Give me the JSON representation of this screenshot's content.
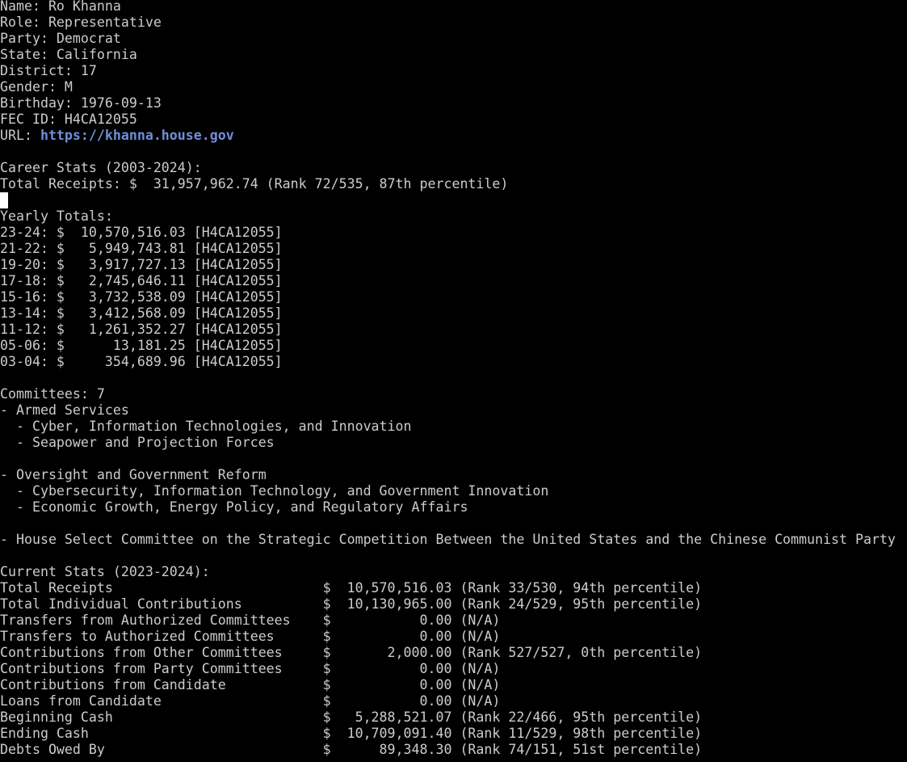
{
  "profile": {
    "name_line": "Name: Ro Khanna",
    "role_line": "Role: Representative",
    "party_line": "Party: Democrat",
    "state_line": "State: California",
    "district_line": "District: 17",
    "gender_line": "Gender: M",
    "birthday_line": "Birthday: 1976-09-13",
    "fec_line": "FEC ID: H4CA12055",
    "url_label": "URL: ",
    "url": "https://khanna.house.gov"
  },
  "career": {
    "header": "Career Stats (2003-2024):",
    "total_receipts_line": "Total Receipts: $  31,957,962.74 (Rank 72/535, 87th percentile)"
  },
  "yearly": {
    "header": "Yearly Totals:",
    "rows": [
      "23-24: $  10,570,516.03 [H4CA12055]",
      "21-22: $   5,949,743.81 [H4CA12055]",
      "19-20: $   3,917,727.13 [H4CA12055]",
      "17-18: $   2,745,646.11 [H4CA12055]",
      "15-16: $   3,732,538.09 [H4CA12055]",
      "13-14: $   3,412,568.09 [H4CA12055]",
      "11-12: $   1,261,352.27 [H4CA12055]",
      "05-06: $      13,181.25 [H4CA12055]",
      "03-04: $     354,689.96 [H4CA12055]"
    ]
  },
  "committees": {
    "header": "Committees: 7",
    "groups": [
      {
        "name": "- Armed Services",
        "subs": [
          "  - Cyber, Information Technologies, and Innovation",
          "  - Seapower and Projection Forces"
        ]
      },
      {
        "name": "- Oversight and Government Reform",
        "subs": [
          "  - Cybersecurity, Information Technology, and Government Innovation",
          "  - Economic Growth, Energy Policy, and Regulatory Affairs"
        ]
      },
      {
        "name": "- House Select Committee on the Strategic Competition Between the United States and the Chinese Communist Party",
        "subs": []
      }
    ]
  },
  "current": {
    "header": "Current Stats (2023-2024):",
    "rows": [
      "Total Receipts                          $  10,570,516.03 (Rank 33/530, 94th percentile)",
      "Total Individual Contributions          $  10,130,965.00 (Rank 24/529, 95th percentile)",
      "Transfers from Authorized Committees    $           0.00 (N/A)",
      "Transfers to Authorized Committees      $           0.00 (N/A)",
      "Contributions from Other Committees     $       2,000.00 (Rank 527/527, 0th percentile)",
      "Contributions from Party Committees     $           0.00 (N/A)",
      "Contributions from Candidate            $           0.00 (N/A)",
      "Loans from Candidate                    $           0.00 (N/A)",
      "Beginning Cash                          $   5,288,521.07 (Rank 22/466, 95th percentile)",
      "Ending Cash                             $  10,709,091.40 (Rank 11/529, 98th percentile)",
      "Debts Owed By                           $      89,348.30 (Rank 74/151, 51st percentile)"
    ]
  },
  "colors": {
    "background": "#000000",
    "text": "#cccccc",
    "link": "#6f8fd8",
    "cursor": "#ffffff"
  }
}
